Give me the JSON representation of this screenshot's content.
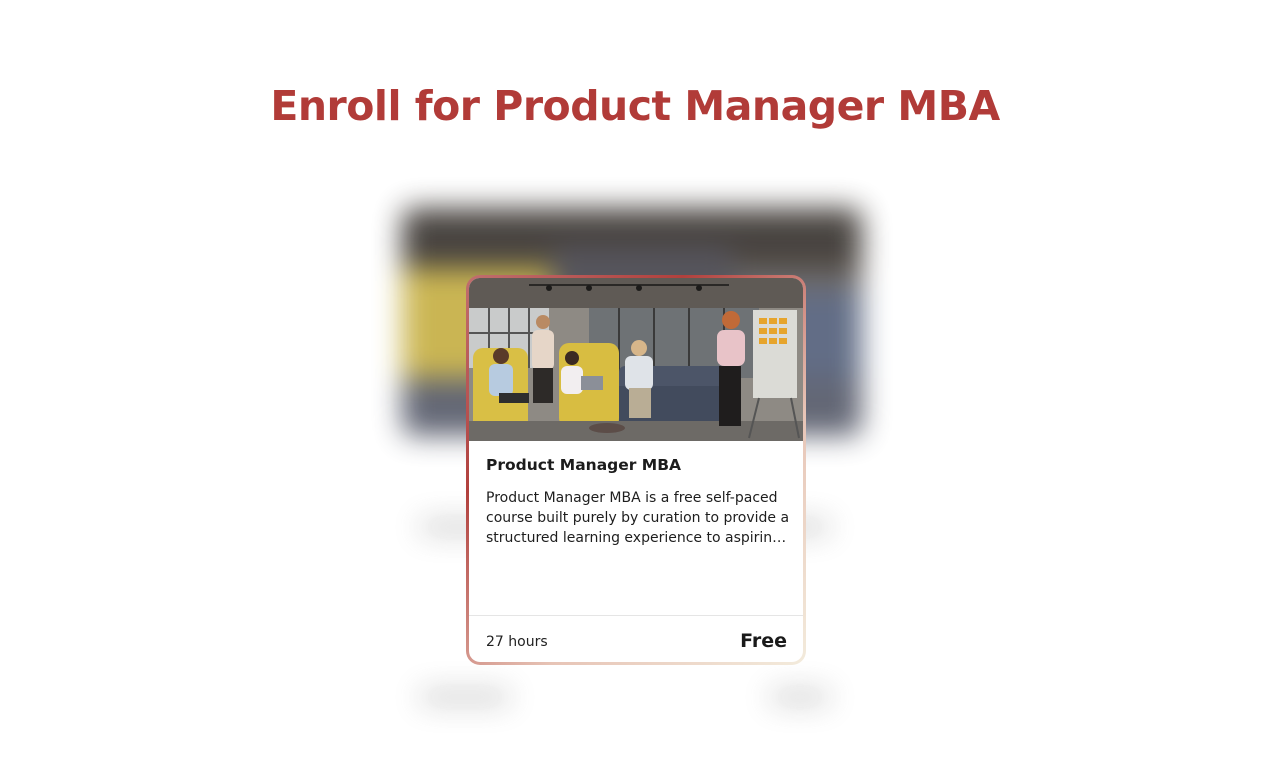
{
  "page": {
    "title": "Enroll for Product Manager MBA",
    "accent_color": "#b13b38"
  },
  "course_card": {
    "image": "team-meeting-photo",
    "title": "Product Manager MBA",
    "description": "Product Manager MBA is a free self-paced course built purely by curation to provide a structured learning experience to aspiring product managers.",
    "duration": "27 hours",
    "price": "Free",
    "border_gradient": [
      "#b1403d",
      "#f3ebdc"
    ]
  }
}
